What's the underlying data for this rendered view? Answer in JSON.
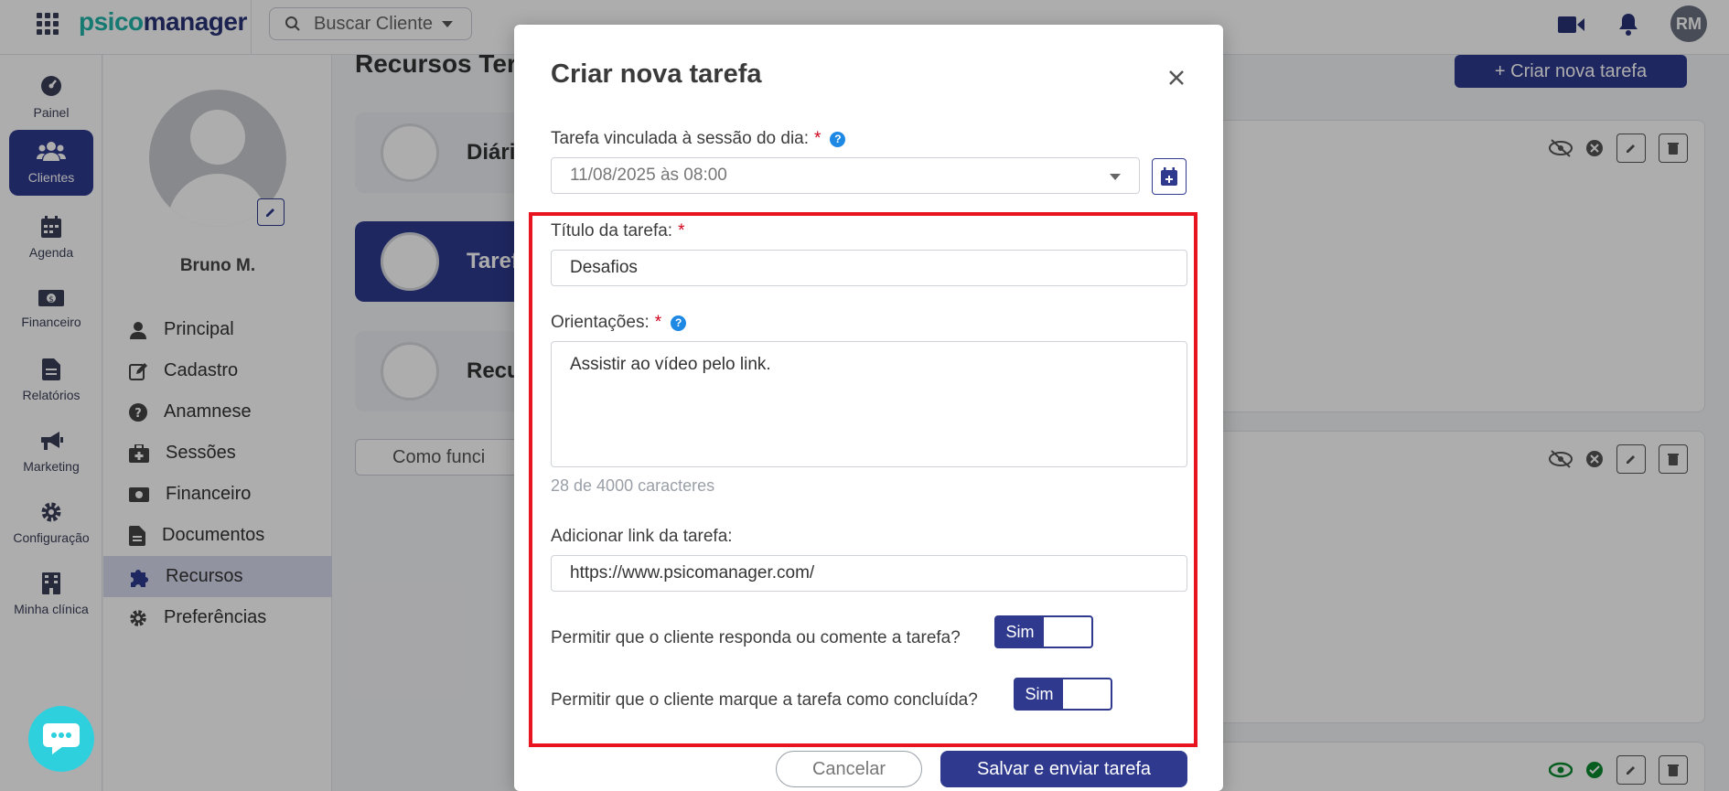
{
  "app": {
    "logo_part1": "psico",
    "logo_part2": "manager",
    "user_initials": "RM"
  },
  "header": {
    "search_placeholder": "Buscar Cliente"
  },
  "leftnav": {
    "items": [
      {
        "label": "Painel",
        "icon": "dashboard-icon"
      },
      {
        "label": "Clientes",
        "icon": "users-icon",
        "active": true
      },
      {
        "label": "Agenda",
        "icon": "calendar-icon"
      },
      {
        "label": "Financeiro",
        "icon": "money-icon"
      },
      {
        "label": "Relatórios",
        "icon": "report-icon"
      },
      {
        "label": "Marketing",
        "icon": "megaphone-icon"
      },
      {
        "label": "Configuração",
        "icon": "gear-icon"
      },
      {
        "label": "Minha clínica",
        "icon": "building-icon"
      }
    ]
  },
  "profile": {
    "name": "Bruno M.",
    "menu": [
      {
        "label": "Principal",
        "icon": "user-icon"
      },
      {
        "label": "Cadastro",
        "icon": "edit-icon"
      },
      {
        "label": "Anamnese",
        "icon": "question-icon"
      },
      {
        "label": "Sessões",
        "icon": "medkit-icon"
      },
      {
        "label": "Financeiro",
        "icon": "money-icon"
      },
      {
        "label": "Documentos",
        "icon": "document-icon"
      },
      {
        "label": "Recursos",
        "icon": "puzzle-icon",
        "active": true
      },
      {
        "label": "Preferências",
        "icon": "gear-icon"
      }
    ]
  },
  "content": {
    "title": "Recursos Ter",
    "cards": [
      {
        "label": "Diári"
      },
      {
        "label": "Taref",
        "active": true
      },
      {
        "label": "Recu"
      }
    ],
    "how_button": "Como funci",
    "create_button": "+ Criar nova tarefa"
  },
  "modal": {
    "title": "Criar nova tarefa",
    "session_label": "Tarefa vinculada à sessão do dia:",
    "session_value": "11/08/2025 às 08:00",
    "title_label": "Título da tarefa:",
    "title_value": "Desafios",
    "guidance_label": "Orientações:",
    "guidance_value": "Assistir ao vídeo pelo link.",
    "char_counter": "28 de 4000 caracteres",
    "link_label": "Adicionar link da tarefa:",
    "link_value": "https://www.psicomanager.com/",
    "allow_reply_label": "Permitir que o cliente responda ou comente a tarefa?",
    "allow_reply_toggle": "Sim",
    "allow_complete_label": "Permitir que o cliente marque a tarefa como concluída?",
    "allow_complete_toggle": "Sim",
    "required_mark": "*",
    "help_mark": "?",
    "cancel_label": "Cancelar",
    "save_label": "Salvar e enviar tarefa"
  },
  "colors": {
    "brand": "#2f3a8f",
    "accent": "#21b3a8",
    "highlight": "#e8141f",
    "help": "#1e88e5"
  }
}
